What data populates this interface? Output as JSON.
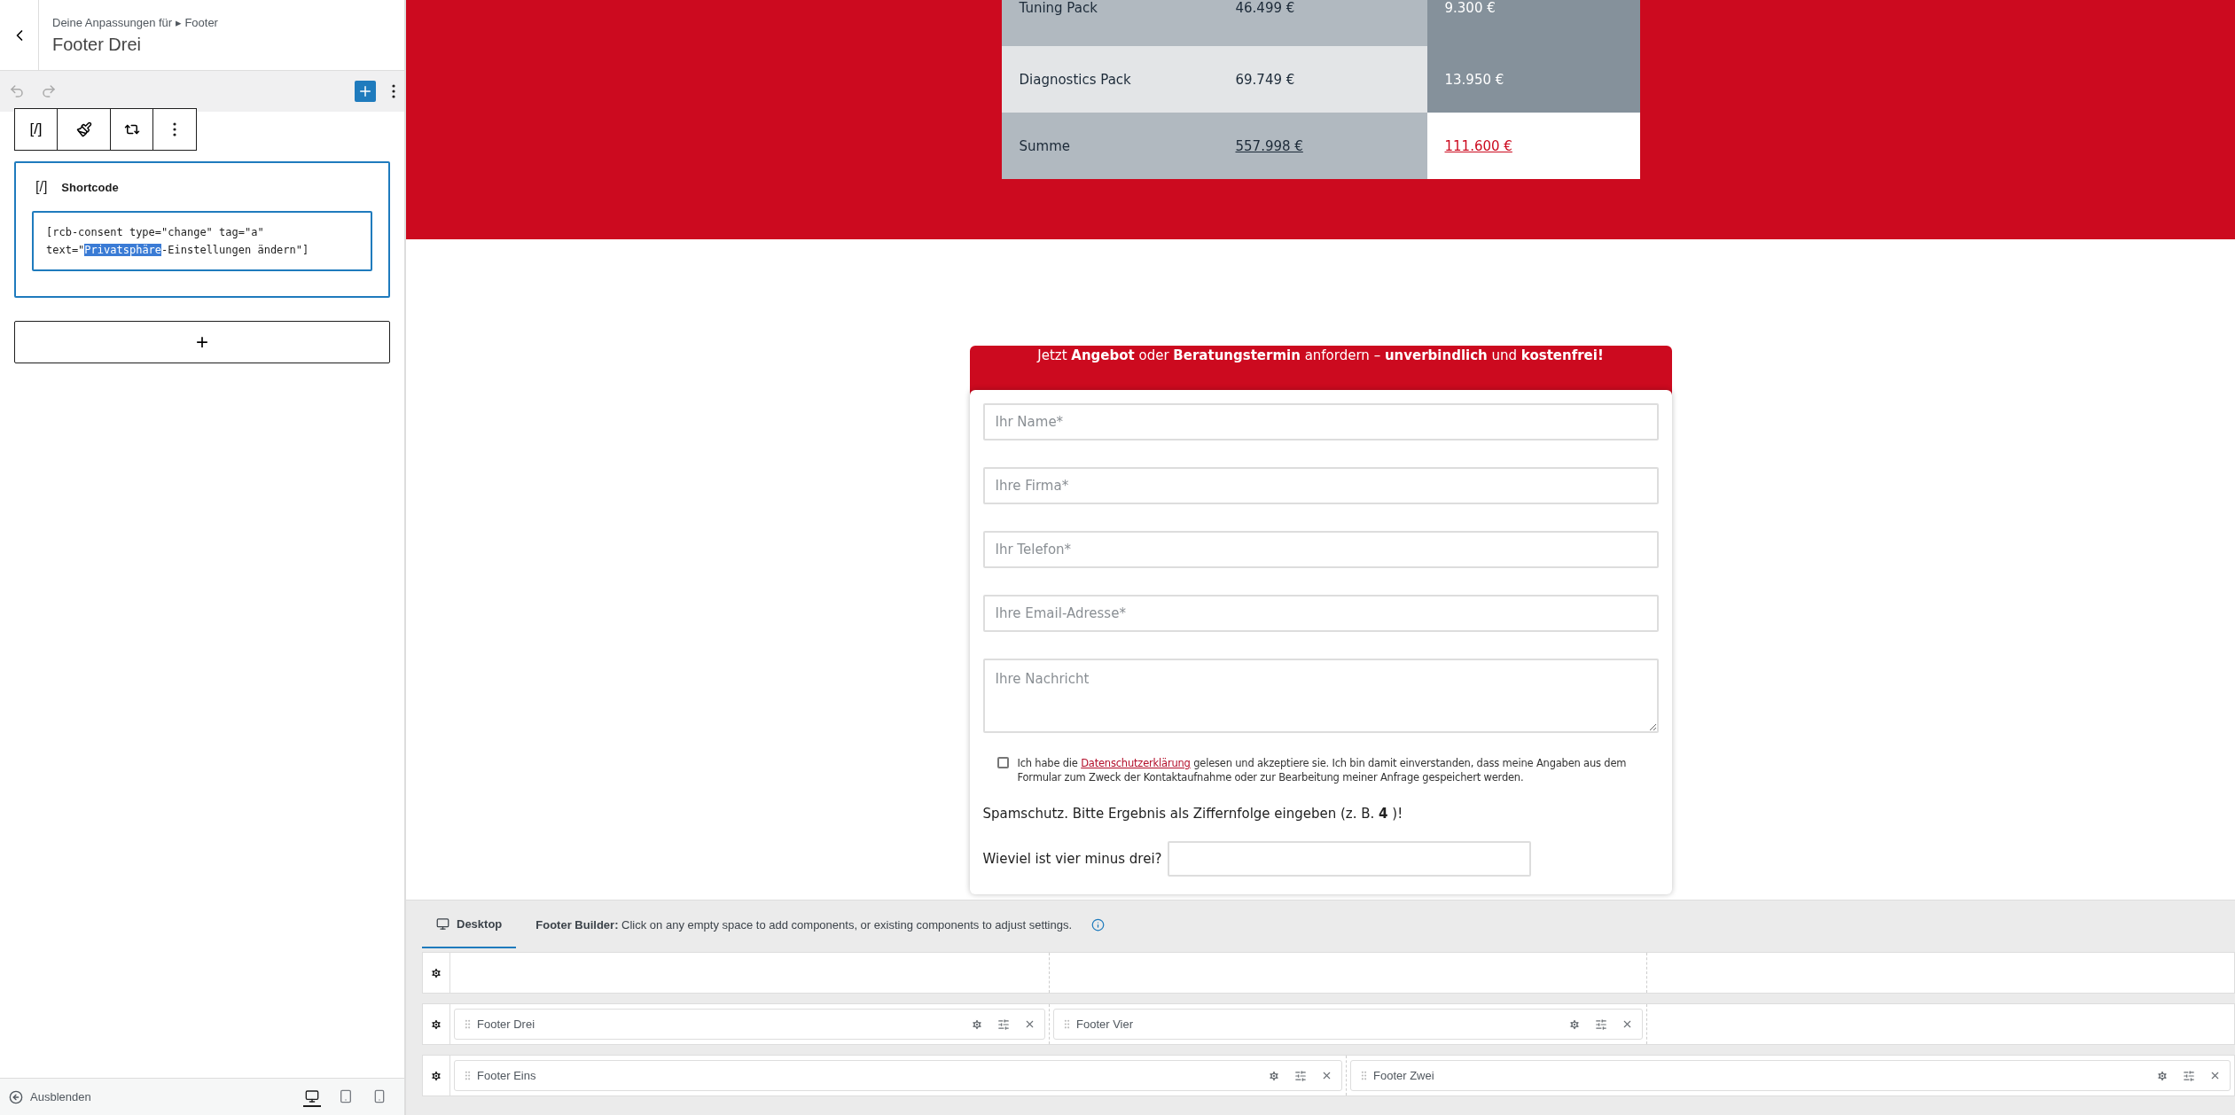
{
  "sidebar": {
    "breadcrumb": "Deine Anpassungen für ▸ Footer",
    "title": "Footer Drei",
    "block_toolbar_icon": "[/]",
    "block": {
      "icon": "[/]",
      "label": "Shortcode",
      "code_line_1": "[rcb-consent type=\"change\" tag=\"a\"",
      "code_before": "text=\"",
      "code_selected": "Privatsphäre",
      "code_after": "-Einstellungen ändern\"]"
    },
    "add_button": "+",
    "hide_label": "Ausblenden",
    "devices": [
      {
        "kind": "desktop",
        "selected": true
      },
      {
        "kind": "tablet",
        "selected": false
      },
      {
        "kind": "mobile",
        "selected": false
      }
    ]
  },
  "preview": {
    "table": {
      "rows": [
        {
          "kind": "item",
          "label": "Tuning Pack",
          "value": "46.499 €",
          "extra": "9.300 €"
        },
        {
          "kind": "item",
          "label": "Diagnostics Pack",
          "value": "69.749 €",
          "extra": "13.950 €"
        },
        {
          "kind": "total",
          "label": "Summe",
          "value": "557.998 €",
          "extra": "111.600 €"
        }
      ]
    },
    "form": {
      "header": "Jetzt **Angebot** oder **Beratungstermin** anfordern – **unverbindlich** und **kostenfrei!**",
      "fields": [
        {
          "kind": "input",
          "placeholder": "Ihr Name*"
        },
        {
          "kind": "input",
          "placeholder": "Ihre Firma*"
        },
        {
          "kind": "input",
          "placeholder": "Ihr Telefon*"
        },
        {
          "kind": "input",
          "placeholder": "Ihre Email-Adresse*"
        },
        {
          "kind": "textarea",
          "placeholder": "Ihre Nachricht"
        }
      ],
      "consent": {
        "checked": false,
        "before": "Ich habe die",
        "link": "Datenschutzerklärung",
        "after": "gelesen und akzeptiere sie. Ich bin damit einverstanden, dass meine Angaben aus dem Formular zum Zweck der Kontaktaufnahme oder zur Bearbeitung meiner Anfrage gespeichert werden."
      },
      "spam_hint": "Spamschutz. Bitte Ergebnis als Ziffernfolge eingeben (z. B. **4** )!",
      "question": "Wieviel ist vier minus drei?"
    }
  },
  "footer_builder": {
    "tabs": [
      {
        "label": "Desktop",
        "selected": true
      }
    ],
    "info": "**Footer Builder:** Click on any empty space to add components, or existing components to adjust settings.",
    "rows": [
      {
        "kind": "three-column",
        "items": []
      },
      {
        "kind": "three-column",
        "items": [
          {
            "label": "Footer Drei"
          },
          {
            "label": "Footer Vier"
          }
        ]
      },
      {
        "kind": "two-column",
        "items": [
          {
            "label": "Footer Eins"
          },
          {
            "label": "Footer Zwei"
          }
        ]
      }
    ]
  }
}
